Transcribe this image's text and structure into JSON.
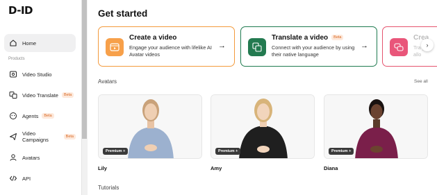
{
  "sidebar": {
    "logo": "D-ID",
    "home": "Home",
    "section_label": "Products",
    "items": [
      {
        "label": "Video Studio",
        "icon": "video-studio-icon"
      },
      {
        "label": "Video Translate",
        "badge": "Beta",
        "icon": "translate-icon"
      },
      {
        "label": "Agents",
        "badge": "Beta",
        "icon": "agents-icon"
      },
      {
        "label": "Video Campaigns",
        "badge": "Beta",
        "icon": "campaign-icon"
      },
      {
        "label": "Avatars",
        "icon": "avatars-icon"
      },
      {
        "label": "API",
        "icon": "code-icon"
      }
    ]
  },
  "main": {
    "title": "Get started",
    "cards": [
      {
        "title": "Create a video",
        "desc": "Engage your audience with lifelike AI Avatar videos",
        "accent": "#f39a3c"
      },
      {
        "title": "Translate a video",
        "badge": "Beta",
        "desc": "Connect with your audience by using their native language",
        "accent": "#1e7a4f"
      },
      {
        "title": "Crea",
        "desc": "Tra your allo",
        "accent": "#e5536e"
      }
    ],
    "avatars_label": "Avatars",
    "see_all": "See all",
    "avatars": [
      {
        "name": "Lily",
        "badge": "Premium +"
      },
      {
        "name": "Amy",
        "badge": "Premium +"
      },
      {
        "name": "Diana",
        "badge": "Premium +"
      }
    ],
    "tutorials_label": "Tutorials"
  }
}
